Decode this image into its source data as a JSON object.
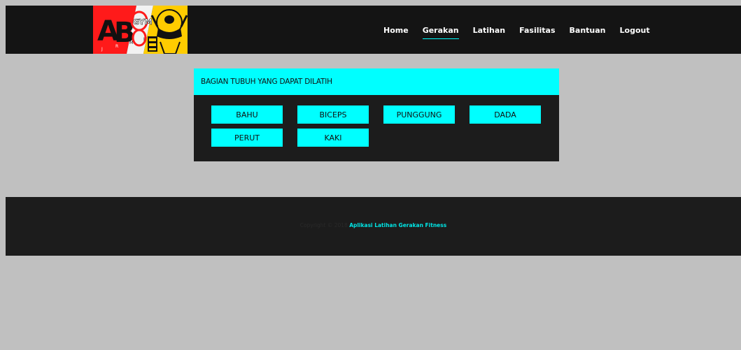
{
  "brand": {
    "logo_text": "AB8 GYM",
    "logo_letters": [
      "J",
      "R",
      "M",
      "I"
    ]
  },
  "nav": {
    "items": [
      {
        "label": "Home",
        "active": false
      },
      {
        "label": "Gerakan",
        "active": true
      },
      {
        "label": "Latihan",
        "active": false
      },
      {
        "label": "Fasilitas",
        "active": false
      },
      {
        "label": "Bantuan",
        "active": false
      },
      {
        "label": "Logout",
        "active": false
      }
    ]
  },
  "card": {
    "title": "BAGIAN TUBUH YANG DAPAT DILATIH",
    "buttons": [
      "BAHU",
      "BICEPS",
      "PUNGGUNG",
      "DADA",
      "PERUT",
      "KAKI"
    ]
  },
  "footer": {
    "copyright": "Copyright © 2018",
    "app_name": "Aplikasi Latihan Gerakan Fitness"
  },
  "colors": {
    "accent": "#00ffff",
    "header_bg": "#141414",
    "card_bg": "#1c1c1c",
    "page_bg": "#c0c0c0"
  }
}
